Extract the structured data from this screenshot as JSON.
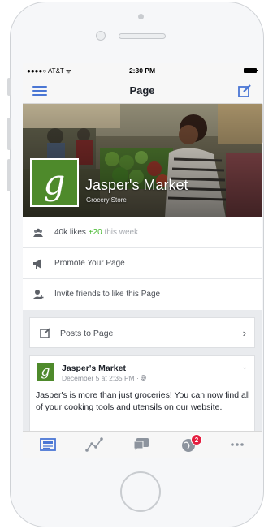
{
  "status_bar": {
    "carrier": "●●●●○ AT&T ᯤ",
    "time": "2:30 PM"
  },
  "nav": {
    "title": "Page",
    "menu_icon": "hamburger-menu-icon",
    "compose_icon": "compose-icon"
  },
  "page": {
    "name": "Jasper's Market",
    "category": "Grocery Store",
    "logo_letter": "g"
  },
  "actions": [
    {
      "icon": "people-icon",
      "text": "40k likes",
      "delta": "+20",
      "period": "this week"
    },
    {
      "icon": "megaphone-icon",
      "text": "Promote Your Page"
    },
    {
      "icon": "add-friend-icon",
      "text": "Invite friends to like this Page"
    }
  ],
  "posts_to_page": {
    "label": "Posts to Page",
    "chevron": "›"
  },
  "post": {
    "author": "Jasper's Market",
    "date": "December 5 at 2:35 PM · ",
    "text": "Jasper's is more than just groceries! You can now find all of your cooking tools and utensils on our website.",
    "chevron": "⌄"
  },
  "tabs": [
    {
      "name": "page-tab",
      "icon": "page-icon"
    },
    {
      "name": "insights-tab",
      "icon": "insights-chart-icon"
    },
    {
      "name": "messages-tab",
      "icon": "messages-icon"
    },
    {
      "name": "notifications-tab",
      "icon": "globe-notifications-icon",
      "badge": "2"
    },
    {
      "name": "more-tab",
      "icon": "more-dots-icon"
    }
  ],
  "colors": {
    "accent": "#4a76d4",
    "brand_green": "#4e8a2b",
    "badge_red": "#e41e3f",
    "positive": "#42b72a"
  }
}
